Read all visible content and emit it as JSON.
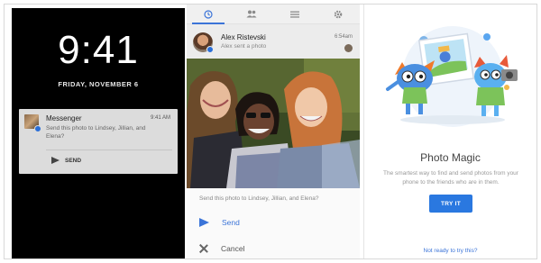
{
  "lock_screen": {
    "time": "9:41",
    "date": "FRIDAY, NOVEMBER 6",
    "notification": {
      "app": "Messenger",
      "time": "9:41 AM",
      "message": "Send this photo to Lindsey, Jillian, and Elena?",
      "action_label": "SEND",
      "action_icon": "send-icon"
    }
  },
  "app_notification": {
    "tabs": [
      {
        "icon": "clock-icon",
        "active": true
      },
      {
        "icon": "people-icon",
        "active": false
      },
      {
        "icon": "list-icon",
        "active": false
      },
      {
        "icon": "gear-icon",
        "active": false
      }
    ],
    "sender": "Alex Ristevski",
    "subtitle": "Alex sent a photo",
    "time": "6:54am",
    "prompt": "Send this photo to Lindsey, Jillian, and Elena?",
    "send_label": "Send",
    "cancel_label": "Cancel"
  },
  "photo_magic": {
    "title": "Photo Magic",
    "description": "The smartest way to find and send photos from your phone to the friends who are in them.",
    "try_button": "TRY IT",
    "decline_link": "Not ready to try this?"
  },
  "colors": {
    "accent": "#2a78e0",
    "lock_background": "#000000"
  }
}
